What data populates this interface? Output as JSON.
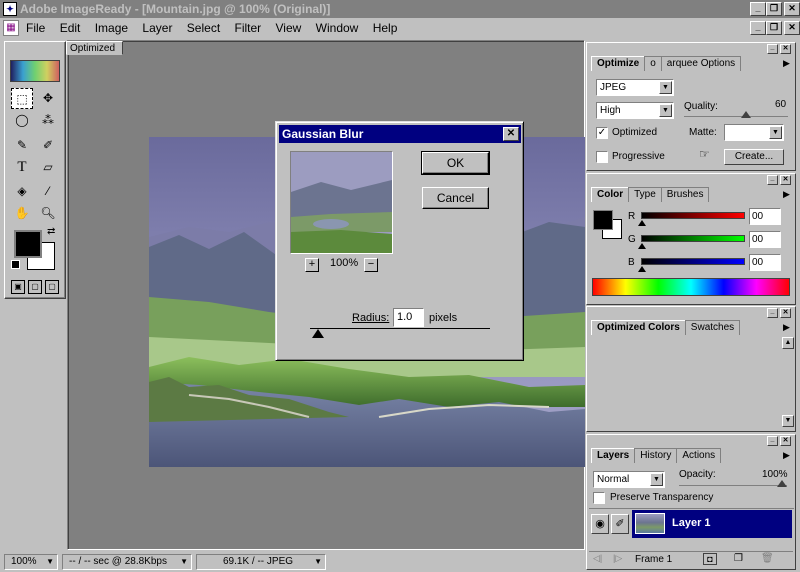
{
  "app": {
    "title": "Adobe ImageReady - [Mountain.jpg @ 100% (Original)]"
  },
  "menu": [
    "File",
    "Edit",
    "Image",
    "Layer",
    "Select",
    "Filter",
    "View",
    "Window",
    "Help"
  ],
  "document": {
    "tab_label": "Optimized"
  },
  "dialog": {
    "title": "Gaussian Blur",
    "ok_label": "OK",
    "cancel_label": "Cancel",
    "zoom_in": "+",
    "zoom_out": "−",
    "zoom_level": "100%",
    "radius_label": "Radius:",
    "radius_value": "1.0",
    "radius_unit": "pixels",
    "close_glyph": "✕"
  },
  "optimize_panel": {
    "tabs": [
      "Optimize",
      "Info",
      "Marquee Options"
    ],
    "tab_display": [
      "Optimize",
      "o",
      "arquee Options"
    ],
    "format": "JPEG",
    "quality_preset": "High",
    "quality_label": "Quality:",
    "quality_value": "60",
    "optimized_label": "Optimized",
    "optimized_checked": true,
    "matte_label": "Matte:",
    "progressive_label": "Progressive",
    "progressive_checked": false,
    "create_label": "Create..."
  },
  "color_panel": {
    "tabs": [
      "Color",
      "Type",
      "Brushes"
    ],
    "r_label": "R",
    "g_label": "G",
    "b_label": "B",
    "r_value": "00",
    "g_value": "00",
    "b_value": "00",
    "foreground": "#000000",
    "background": "#ffffff"
  },
  "opt_colors_panel": {
    "tabs": [
      "Optimized Colors",
      "Swatches"
    ]
  },
  "layers_panel": {
    "tabs": [
      "Layers",
      "History",
      "Actions"
    ],
    "blend_mode": "Normal",
    "opacity_label": "Opacity:",
    "opacity_value": "100%",
    "preserve_label": "Preserve Transparency",
    "layer_name": "Layer 1",
    "frame_label": "Frame 1"
  },
  "status": {
    "zoom": "100%",
    "download": "-- / -- sec @ 28.8Kbps",
    "size": "69.1K / -- JPEG"
  },
  "colors": {
    "title_active": "#000080",
    "title_inactive": "#808080",
    "face": "#c0c0c0"
  }
}
